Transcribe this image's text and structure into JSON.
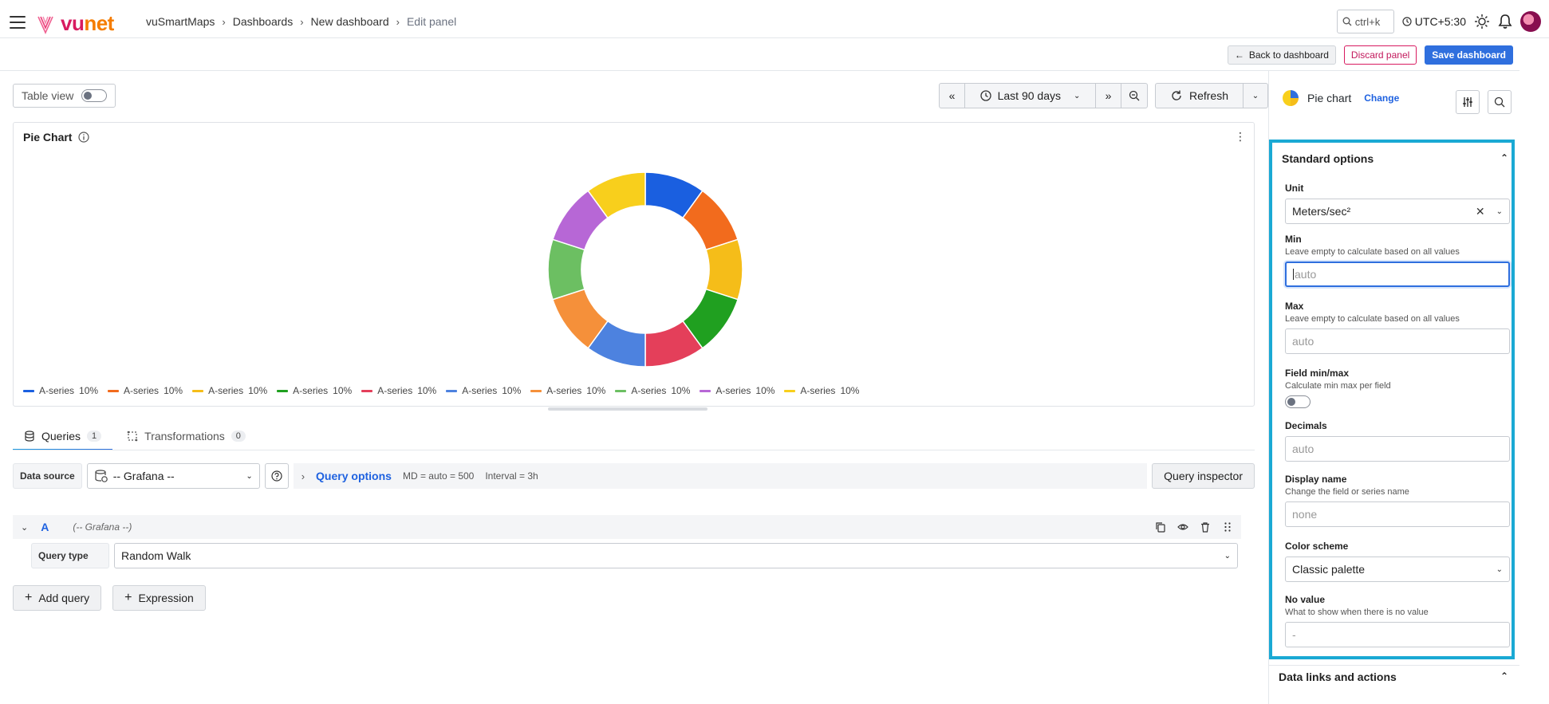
{
  "header": {
    "logo_text_a": "vu",
    "logo_text_b": "net",
    "breadcrumb": [
      "vuSmartMaps",
      "Dashboards",
      "New dashboard",
      "Edit panel"
    ],
    "search_hint": "ctrl+k",
    "timezone": "UTC+5:30"
  },
  "actions": {
    "back": "Back to dashboard",
    "discard": "Discard panel",
    "save": "Save dashboard"
  },
  "toolbar": {
    "table_view": "Table view",
    "time_range": "Last 90 days",
    "refresh": "Refresh"
  },
  "panel": {
    "title": "Pie Chart"
  },
  "chart_data": {
    "type": "pie",
    "title": "Pie Chart",
    "donut": true,
    "legend_position": "bottom",
    "slices": [
      {
        "label": "A-series",
        "value": 10,
        "percent": "10%",
        "color": "#1a5fe0"
      },
      {
        "label": "A-series",
        "value": 10,
        "percent": "10%",
        "color": "#f26b1d"
      },
      {
        "label": "A-series",
        "value": 10,
        "percent": "10%",
        "color": "#f5bd19"
      },
      {
        "label": "A-series",
        "value": 10,
        "percent": "10%",
        "color": "#20a020"
      },
      {
        "label": "A-series",
        "value": 10,
        "percent": "10%",
        "color": "#e43f5a"
      },
      {
        "label": "A-series",
        "value": 10,
        "percent": "10%",
        "color": "#4d82df"
      },
      {
        "label": "A-series",
        "value": 10,
        "percent": "10%",
        "color": "#f5903a"
      },
      {
        "label": "A-series",
        "value": 10,
        "percent": "10%",
        "color": "#6cbf62"
      },
      {
        "label": "A-series",
        "value": 10,
        "percent": "10%",
        "color": "#b767d6"
      },
      {
        "label": "A-series",
        "value": 10,
        "percent": "10%",
        "color": "#f8cf1c"
      }
    ]
  },
  "query_tabs": {
    "queries_label": "Queries",
    "queries_count": "1",
    "transformations_label": "Transformations",
    "transformations_count": "0"
  },
  "datasource": {
    "label": "Data source",
    "value": "-- Grafana --",
    "query_options": "Query options",
    "md": "MD = auto = 500",
    "interval": "Interval = 3h",
    "inspector": "Query inspector"
  },
  "query": {
    "ref": "A",
    "source": "(-- Grafana --)",
    "type_label": "Query type",
    "type_value": "Random Walk",
    "add_query": "Add query",
    "expression": "Expression"
  },
  "viz": {
    "name": "Pie chart",
    "change": "Change"
  },
  "options": {
    "section": "Standard options",
    "unit_label": "Unit",
    "unit_value": "Meters/sec²",
    "min_label": "Min",
    "min_desc": "Leave empty to calculate based on all values",
    "min_placeholder": "auto",
    "max_label": "Max",
    "max_desc": "Leave empty to calculate based on all values",
    "max_placeholder": "auto",
    "fieldminmax_label": "Field min/max",
    "fieldminmax_desc": "Calculate min max per field",
    "decimals_label": "Decimals",
    "decimals_placeholder": "auto",
    "display_label": "Display name",
    "display_desc": "Change the field or series name",
    "display_placeholder": "none",
    "color_label": "Color scheme",
    "color_value": "Classic palette",
    "novalue_label": "No value",
    "novalue_desc": "What to show when there is no value",
    "novalue_placeholder": "-",
    "data_links": "Data links and actions"
  }
}
